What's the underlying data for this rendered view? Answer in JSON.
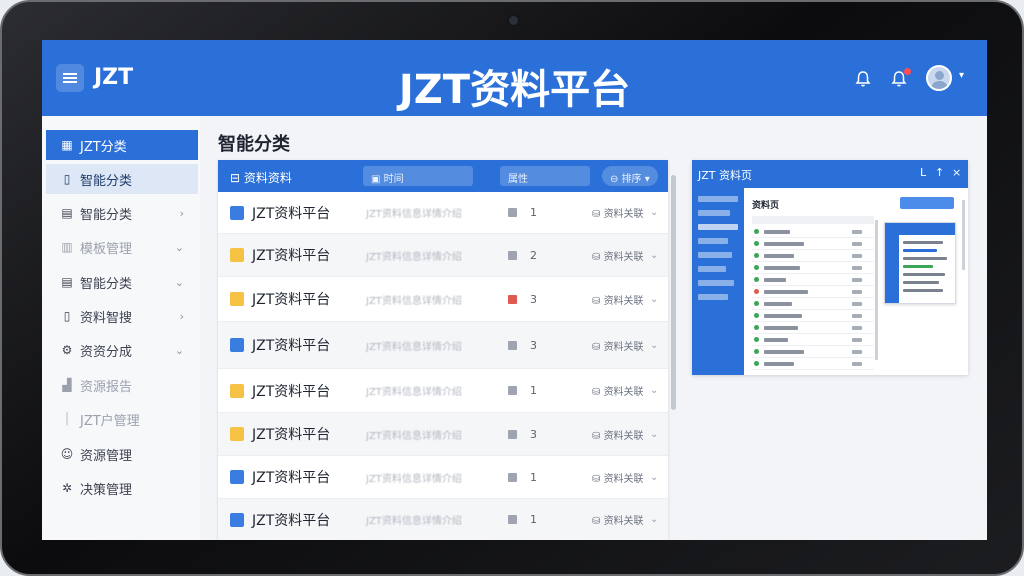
{
  "header": {
    "logo": "JZT",
    "title": "JZT资料平台"
  },
  "colors": {
    "primary": "#2a70d8",
    "sidebar_bg": "#f7f8fa",
    "badge": "#ff4d4f"
  },
  "sidebar": {
    "items": [
      {
        "label": "JZT分类",
        "icon": "grid-icon"
      },
      {
        "label": "智能分类",
        "icon": "file-icon"
      },
      {
        "label": "智能分类",
        "icon": "document-icon"
      },
      {
        "label": "模板管理",
        "icon": "template-icon"
      },
      {
        "label": "智能分类",
        "icon": "list-icon"
      },
      {
        "label": "资料智搜",
        "icon": "file-search-icon"
      },
      {
        "label": "资资分成",
        "icon": "gear-icon"
      },
      {
        "label": "资源报告",
        "icon": "chart-icon"
      },
      {
        "label": "JZT户管理",
        "icon": "user-icon"
      },
      {
        "label": "资源管理",
        "icon": "users-icon"
      },
      {
        "label": "决策管理",
        "icon": "settings-icon"
      }
    ]
  },
  "page": {
    "heading": "智能分类"
  },
  "table": {
    "header": {
      "title": "资料资料",
      "chip1": "时间",
      "chip2": "属性",
      "chip3": "排序"
    },
    "rows": [
      {
        "name": "JZT资料平台",
        "desc": "JZT资料信息详情介绍",
        "count": "1",
        "action": "资料关联",
        "icon_color": "#3a7de0",
        "flag_color": "#9ea5b0"
      },
      {
        "name": "JZT资料平台",
        "desc": "JZT资料信息详情介绍",
        "count": "2",
        "action": "资料关联",
        "icon_color": "#f5c243",
        "flag_color": "#9ea5b0"
      },
      {
        "name": "JZT资料平台",
        "desc": "JZT资料信息详情介绍",
        "count": "3",
        "action": "资料关联",
        "icon_color": "#f5c243",
        "flag_color": "#e05a52"
      },
      {
        "name": "JZT资料平台",
        "desc": "JZT资料信息详情介绍",
        "count": "3",
        "action": "资料关联",
        "icon_color": "#3a7de0",
        "flag_color": "#9ea5b0"
      },
      {
        "name": "JZT资料平台",
        "desc": "JZT资料信息详情介绍",
        "count": "1",
        "action": "资料关联",
        "icon_color": "#f5c243",
        "flag_color": "#9ea5b0"
      },
      {
        "name": "JZT资料平台",
        "desc": "JZT资料信息详情介绍",
        "count": "3",
        "action": "资料关联",
        "icon_color": "#f5c243",
        "flag_color": "#9ea5b0"
      },
      {
        "name": "JZT资料平台",
        "desc": "JZT资料信息详情介绍",
        "count": "1",
        "action": "资料关联",
        "icon_color": "#3a7de0",
        "flag_color": "#9ea5b0"
      },
      {
        "name": "JZT资料平台",
        "desc": "JZT资料信息详情介绍",
        "count": "1",
        "action": "资料关联",
        "icon_color": "#3a7de0",
        "flag_color": "#9ea5b0"
      }
    ]
  },
  "preview": {
    "title": "JZT 资料页",
    "heading": "资料页",
    "controls": [
      "L",
      "↑",
      "×"
    ]
  }
}
